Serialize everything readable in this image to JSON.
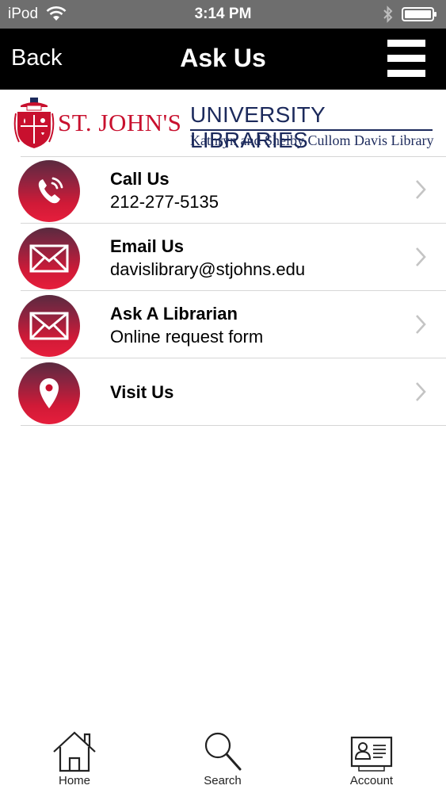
{
  "status_bar": {
    "carrier": "iPod",
    "time": "3:14 PM",
    "icons": [
      "wifi-icon",
      "bluetooth-icon",
      "battery-icon"
    ]
  },
  "nav": {
    "back_label": "Back",
    "title": "Ask Us",
    "menu_icon": "hamburger-menu-icon"
  },
  "header": {
    "name": "ST. JOHN'S",
    "university": "UNIVERSITY LIBRARIES",
    "library": "Kathryn and Shelby Cullom Davis Library",
    "brand_red": "#c8102e",
    "brand_navy": "#1c2a5c"
  },
  "items": [
    {
      "title": "Call Us",
      "subtitle": "212-277-5135",
      "icon": "phone-icon"
    },
    {
      "title": "Email Us",
      "subtitle": "davislibrary@stjohns.edu",
      "icon": "envelope-icon"
    },
    {
      "title": "Ask A Librarian",
      "subtitle": "Online request form",
      "icon": "envelope-icon"
    },
    {
      "title": "Visit Us",
      "subtitle": "",
      "icon": "map-pin-icon"
    }
  ],
  "tabs": [
    {
      "label": "Home",
      "icon": "home-icon"
    },
    {
      "label": "Search",
      "icon": "search-icon"
    },
    {
      "label": "Account",
      "icon": "account-card-icon"
    }
  ],
  "colors": {
    "nav_background": "#000000",
    "status_background": "#6e6e6e",
    "icon_red": "#e61e3c",
    "icon_dark": "#5a2a3f"
  }
}
